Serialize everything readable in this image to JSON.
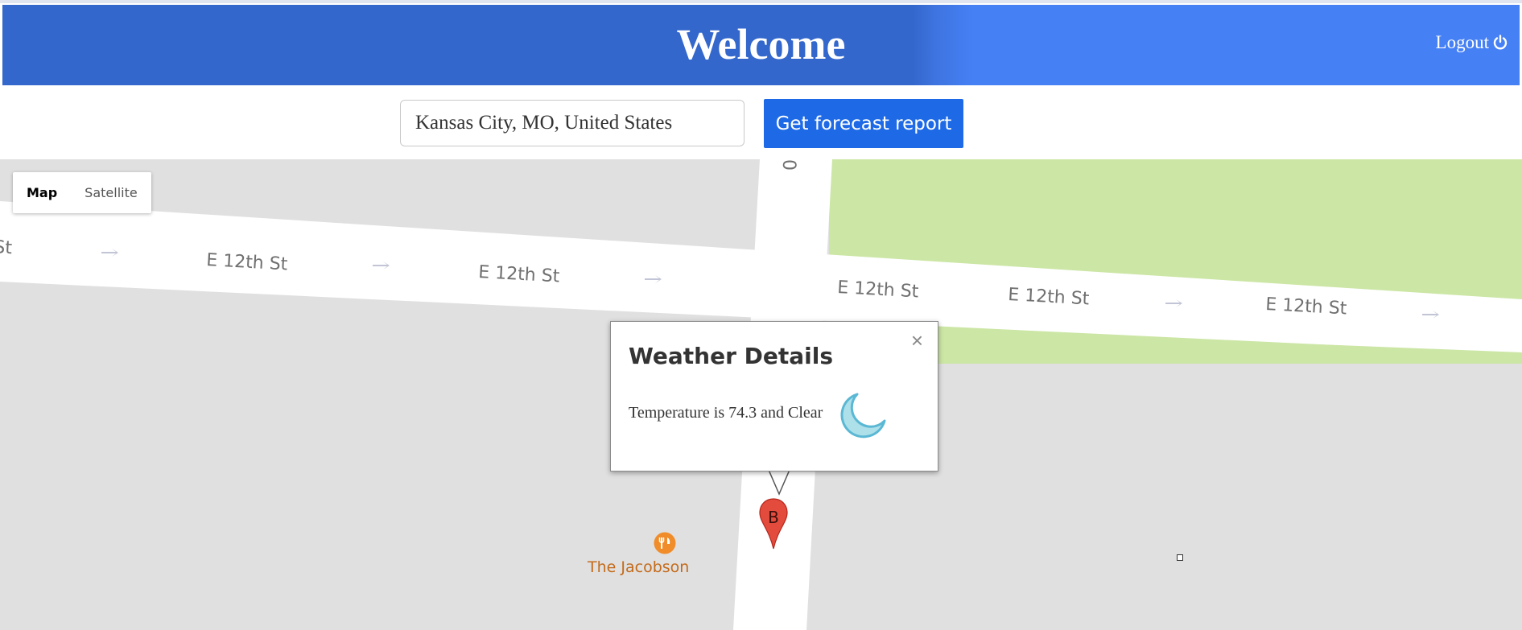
{
  "header": {
    "title": "Welcome",
    "logout_label": "Logout",
    "logout_icon": "power-icon"
  },
  "search": {
    "value": "Kansas City, MO, United States",
    "button_label": "Get forecast report"
  },
  "map": {
    "type_controls": [
      "Map",
      "Satellite"
    ],
    "active_type": "Map",
    "street_labels": [
      "St",
      "E 12th St",
      "E 12th St",
      "E 12th St",
      "E 12th St",
      "E 12th St"
    ],
    "cross_street_fragment": "0",
    "poi": {
      "name": "The Jacobson",
      "icon": "restaurant-icon"
    },
    "marker": {
      "label": "B",
      "color": "#e34b3d"
    }
  },
  "info_window": {
    "title": "Weather Details",
    "close_symbol": "×",
    "text": "Temperature is 74.3 and Clear",
    "icon": "moon-icon"
  },
  "colors": {
    "header": "#3367cc",
    "header_right": "#4580f5",
    "button": "#1e6ae6",
    "park": "#cce6a5",
    "map_background": "#e0e0e0"
  }
}
